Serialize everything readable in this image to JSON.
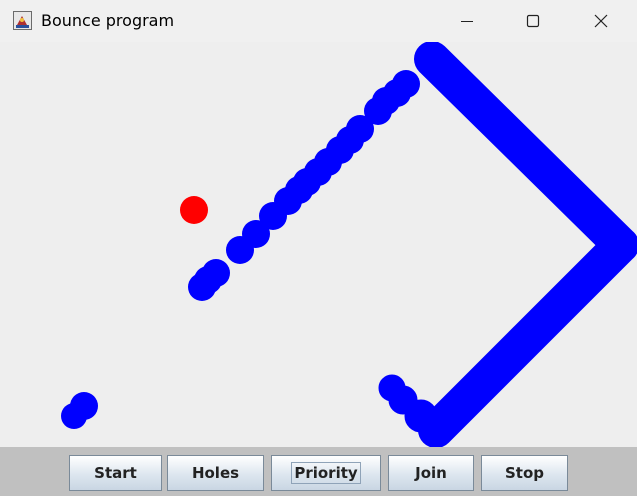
{
  "window": {
    "title": "Bounce program",
    "controls": {
      "minimize": "minimize-icon",
      "maximize": "maximize-icon",
      "close": "close-icon"
    }
  },
  "canvas": {
    "background": "#eeeeee",
    "ball_colors": {
      "red": "#ff0000",
      "blue": "#0000ff"
    }
  },
  "buttons": {
    "start": "Start",
    "holes": "Holes",
    "priority": "Priority",
    "join": "Join",
    "stop": "Stop"
  }
}
